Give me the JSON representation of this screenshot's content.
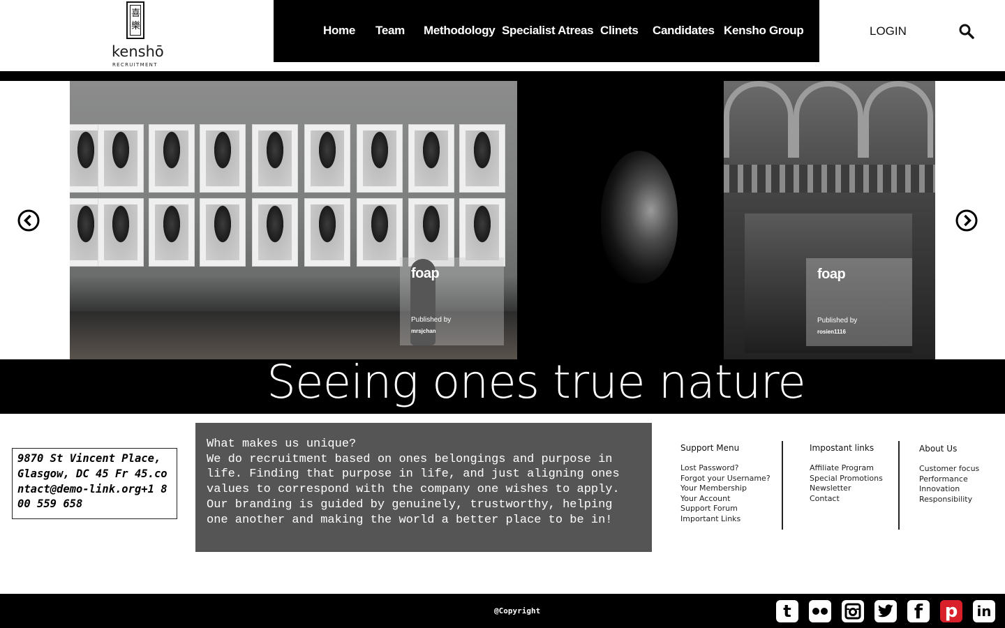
{
  "brand": {
    "name": "kenshō",
    "subtitle": "RECRUITMENT",
    "glyphs": "喜樂"
  },
  "nav": {
    "items": [
      "Home",
      "Team",
      "Methodology",
      "Specialist Atreas",
      "Clinets",
      "Candidates",
      "Kensho Group"
    ],
    "login": "LOGIN"
  },
  "slider": {
    "slides": [
      {
        "badge": "foap",
        "published_label": "Published by",
        "user": "mrsjchan"
      },
      {
        "badge": "",
        "published_label": "",
        "user": ""
      },
      {
        "badge": "foap",
        "published_label": "Published by",
        "user": "rosien1116"
      }
    ],
    "tagline": "Seeing ones true nature"
  },
  "contact": {
    "address": "9870 St Vincent Place, Glasgow, DC 45 Fr 45.contact@demo-link.org+1 800 559 658"
  },
  "about_box": {
    "heading": "What makes us unique?",
    "body": "We do recruitment based on ones belongings and purpose in life. Finding that purpose in life, and just aligning ones values to correspond with the company one wishes to apply. Our branding is guided by genuinely, trustworthy, helping one another and making the world a better place to be in!"
  },
  "footer_links": {
    "support": {
      "title": "Support Menu",
      "items": [
        "Lost Password?",
        "Forgot your Username?",
        "Your Membership",
        "Your Account",
        "Support Forum",
        "Important Links"
      ]
    },
    "important": {
      "title": "Impostant links",
      "items": [
        "Affiliate Program",
        "Special Promotions",
        "Newsletter",
        "Contact"
      ]
    },
    "about": {
      "title": "About Us",
      "items": [
        "Customer focus",
        "Performance",
        "Innovation",
        "Responsibility"
      ]
    }
  },
  "footer": {
    "copyright": "@Copyright",
    "social": [
      "tumblr-icon",
      "flickr-icon",
      "instagram-icon",
      "twitter-icon",
      "facebook-icon",
      "pinterest-icon",
      "linkedin-icon"
    ]
  },
  "colors": {
    "black": "#000000",
    "panel_grey": "#555555",
    "pinterest_red": "#d81f2a"
  }
}
